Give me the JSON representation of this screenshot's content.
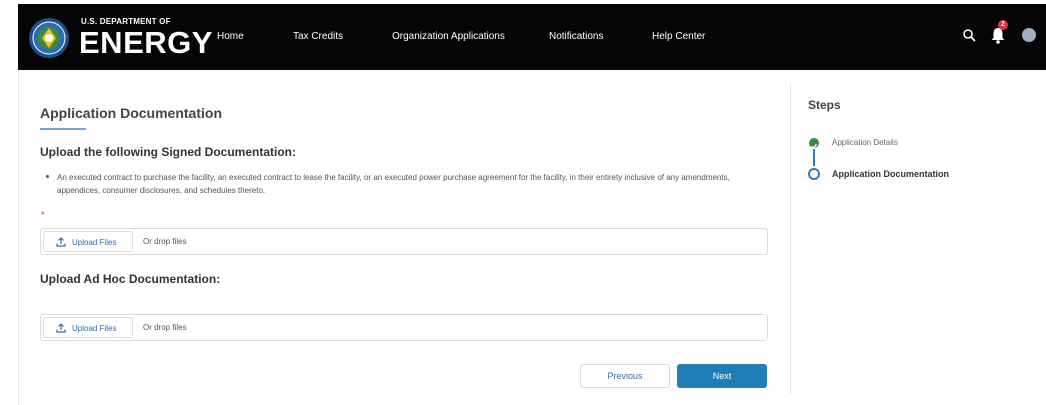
{
  "header": {
    "department": "U.S. DEPARTMENT OF",
    "brand": "ENERGY",
    "nav": [
      "Home",
      "Tax Credits",
      "Organization Applications",
      "Notifications",
      "Help Center"
    ],
    "notification_count": "2",
    "icons": [
      "search-icon",
      "bell-icon",
      "avatar"
    ]
  },
  "main": {
    "title": "Application Documentation",
    "signed_heading": "Upload the following Signed Documentation:",
    "signed_bullet": "An executed contract to purchase the facility, an executed contract to lease the facility, or an executed power purchase agreement for the facility, in their entirety inclusive of any amendments, appendices, consumer disclosures, and schedules thereto.",
    "required_marker": "*",
    "upload_label": "Upload Files",
    "drop_text": "Or drop files",
    "adhoc_heading": "Upload Ad Hoc Documentation:"
  },
  "footer": {
    "previous": "Previous",
    "next": "Next"
  },
  "steps": {
    "title": "Steps",
    "items": [
      {
        "label": "Application Details",
        "status": "complete"
      },
      {
        "label": "Application Documentation",
        "status": "current"
      }
    ]
  },
  "colors": {
    "header_bg": "#050505",
    "accent": "#1e7fb7",
    "complete": "#3b8a3e",
    "required": "#d0312d"
  }
}
